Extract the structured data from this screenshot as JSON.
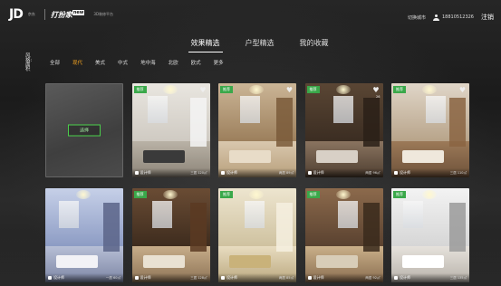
{
  "header": {
    "logo_mark": "JD",
    "logo_sub": "京东",
    "brand": "打扮家",
    "brand_badge": "new",
    "brand_tag": "3D装修平台",
    "link_label": "切换城市",
    "user_name": "18810512326",
    "logout_label": "注销"
  },
  "tabs": [
    {
      "label": "效果精选",
      "active": true
    },
    {
      "label": "户型精选",
      "active": false
    },
    {
      "label": "我的收藏",
      "active": false
    }
  ],
  "filter": {
    "label_line1": "风格:",
    "label_line2": "面积",
    "items": [
      {
        "label": "全部",
        "active": false
      },
      {
        "label": "现代",
        "active": true
      },
      {
        "label": "美式",
        "active": false
      },
      {
        "label": "中式",
        "active": false
      },
      {
        "label": "地中海",
        "active": false
      },
      {
        "label": "北欧",
        "active": false
      },
      {
        "label": "欧式",
        "active": false
      },
      {
        "label": "更多",
        "active": false
      }
    ]
  },
  "placeholder_button": "选择",
  "cards": [
    {
      "tag": "",
      "placeholder": true,
      "author": "",
      "meta": "",
      "favorited": false,
      "fav_count": ""
    },
    {
      "tag": "推荐",
      "placeholder": false,
      "author": "设计师",
      "meta": "三居 120㎡",
      "favorited": true,
      "fav_count": "",
      "theme": "white"
    },
    {
      "tag": "推荐",
      "placeholder": false,
      "author": "设计师",
      "meta": "两居 89㎡",
      "favorited": true,
      "fav_count": "",
      "theme": "warm"
    },
    {
      "tag": "推荐",
      "placeholder": false,
      "author": "设计师",
      "meta": "两居 96㎡",
      "favorited": true,
      "fav_count": "26",
      "theme": "dark"
    },
    {
      "tag": "推荐",
      "placeholder": false,
      "author": "设计师",
      "meta": "三居 110㎡",
      "favorited": true,
      "fav_count": "",
      "theme": "wood"
    },
    {
      "tag": "",
      "placeholder": false,
      "author": "设计师",
      "meta": "一居 60㎡",
      "favorited": false,
      "fav_count": "",
      "theme": "blue"
    },
    {
      "tag": "推荐",
      "placeholder": false,
      "author": "设计师",
      "meta": "三居 128㎡",
      "favorited": false,
      "fav_count": "",
      "theme": "brown"
    },
    {
      "tag": "推荐",
      "placeholder": false,
      "author": "设计师",
      "meta": "两居 85㎡",
      "favorited": false,
      "fav_count": "",
      "theme": "cream"
    },
    {
      "tag": "推荐",
      "placeholder": false,
      "author": "设计师",
      "meta": "两居 92㎡",
      "favorited": false,
      "fav_count": "",
      "theme": "cozy"
    },
    {
      "tag": "推荐",
      "placeholder": false,
      "author": "设计师",
      "meta": "三居 135㎡",
      "favorited": false,
      "fav_count": "",
      "theme": "bright"
    }
  ]
}
